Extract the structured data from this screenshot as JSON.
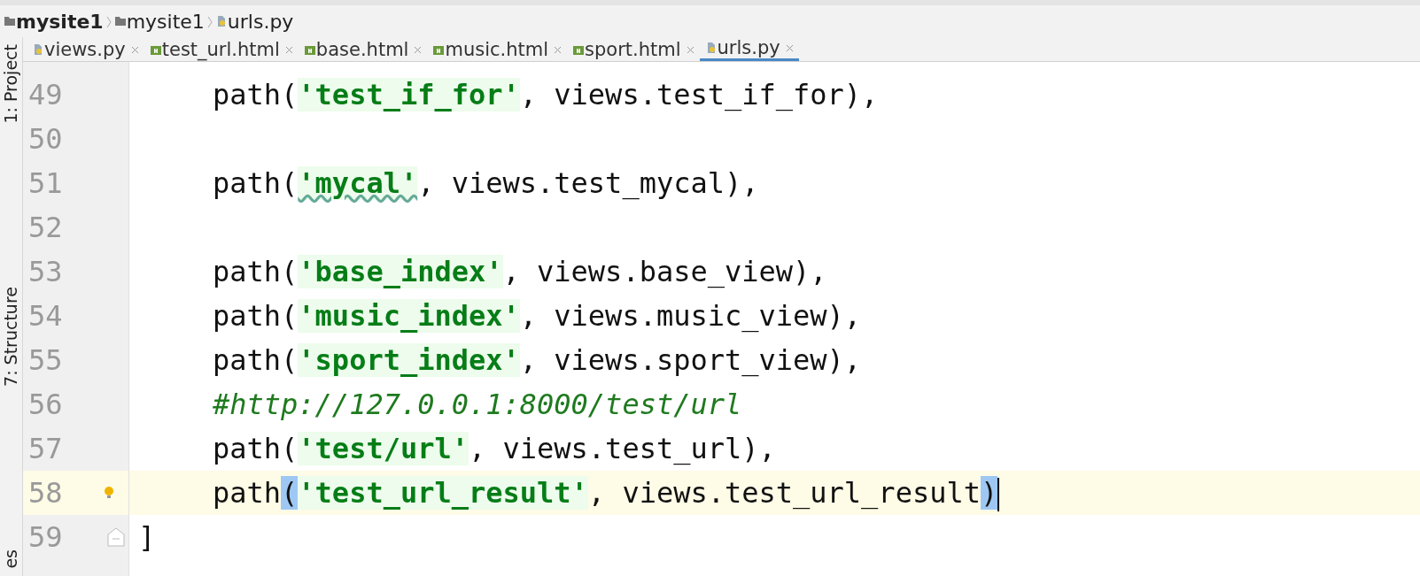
{
  "breadcrumbs": [
    {
      "label": "mysite1",
      "bold": true
    },
    {
      "label": "mysite1",
      "bold": false
    },
    {
      "label": "urls.py",
      "bold": false,
      "kind": "python"
    }
  ],
  "tabs": [
    {
      "label": "views.py",
      "kind": "python",
      "selected": false
    },
    {
      "label": "test_url.html",
      "kind": "html",
      "selected": false
    },
    {
      "label": "base.html",
      "kind": "html",
      "selected": false
    },
    {
      "label": "music.html",
      "kind": "html",
      "selected": false
    },
    {
      "label": "sport.html",
      "kind": "html",
      "selected": false
    },
    {
      "label": "urls.py",
      "kind": "python",
      "selected": true
    }
  ],
  "side_tools": [
    {
      "label": "1: Project"
    },
    {
      "label": "7: Structure"
    },
    {
      "label": "es"
    }
  ],
  "lines": [
    {
      "number": "49",
      "current": false,
      "segments": [
        {
          "kind": "code",
          "text": "path("
        },
        {
          "kind": "string",
          "text": "'test_if_for'",
          "typo": false
        },
        {
          "kind": "code",
          "text": ", views.test_if_for),"
        }
      ]
    },
    {
      "number": "50",
      "current": false
    },
    {
      "number": "51",
      "current": false,
      "segments": [
        {
          "kind": "code",
          "text": "path("
        },
        {
          "kind": "string",
          "text": "'mycal'",
          "typo": true
        },
        {
          "kind": "code",
          "text": ", views.test_mycal),"
        }
      ]
    },
    {
      "number": "52",
      "current": false
    },
    {
      "number": "53",
      "current": false,
      "segments": [
        {
          "kind": "code",
          "text": "path("
        },
        {
          "kind": "string",
          "text": "'base_index'",
          "typo": false
        },
        {
          "kind": "code",
          "text": ", views.base_view),"
        }
      ]
    },
    {
      "number": "54",
      "current": false,
      "segments": [
        {
          "kind": "code",
          "text": "path("
        },
        {
          "kind": "string",
          "text": "'music_index'",
          "typo": false
        },
        {
          "kind": "code",
          "text": ", views.music_view),"
        }
      ]
    },
    {
      "number": "55",
      "current": false,
      "segments": [
        {
          "kind": "code",
          "text": "path("
        },
        {
          "kind": "string",
          "text": "'sport_index'",
          "typo": false
        },
        {
          "kind": "code",
          "text": ", views.sport_view),"
        }
      ]
    },
    {
      "number": "56",
      "current": false,
      "segments": [
        {
          "kind": "comment",
          "text": "#http://127.0.0.1:8000/test/url"
        }
      ]
    },
    {
      "number": "57",
      "current": false,
      "segments": [
        {
          "kind": "code",
          "text": "path("
        },
        {
          "kind": "string",
          "text": "'test/url'",
          "typo": false
        },
        {
          "kind": "code",
          "text": ", views.test_url),"
        }
      ]
    },
    {
      "number": "58",
      "current": true,
      "hint": true,
      "segments": [
        {
          "kind": "code",
          "text": "path"
        },
        {
          "kind": "brace",
          "text": "("
        },
        {
          "kind": "string",
          "text": "'test_url_result'",
          "typo": false
        },
        {
          "kind": "code",
          "text": ", views.test_url_result"
        },
        {
          "kind": "brace",
          "text": ")"
        },
        {
          "kind": "caret"
        }
      ]
    },
    {
      "number": "59",
      "current": false,
      "fold": true,
      "segments": [
        {
          "kind": "code",
          "text": "]",
          "outdent": true
        }
      ]
    }
  ]
}
